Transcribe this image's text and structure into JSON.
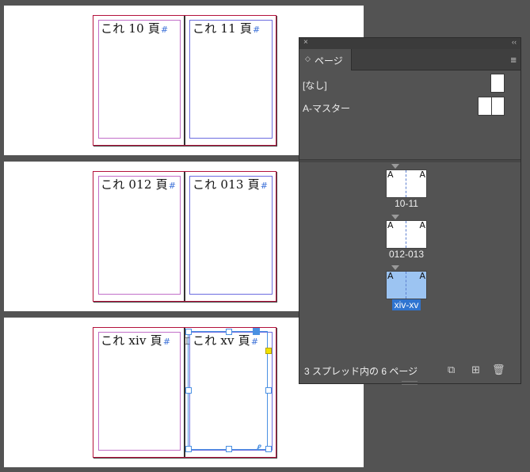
{
  "spreads": [
    {
      "left_label": "これ 10 頁",
      "right_label": "これ 11 頁"
    },
    {
      "left_label": "これ 012 頁",
      "right_label": "これ 013 頁"
    },
    {
      "left_label": "これ xiv 頁",
      "right_label": "これ xv 頁"
    }
  ],
  "marker_glyph": "#",
  "panel": {
    "close_glyph": "×",
    "collapse_glyph": "‹‹",
    "tab_arrows": "◇",
    "tab_label": "ページ",
    "menu_glyph": "≡",
    "masters": [
      {
        "label": "[なし]"
      },
      {
        "label": "A-マスター"
      }
    ],
    "spreads": [
      {
        "name": "10-11",
        "prefix_left": "A",
        "prefix_right": "A",
        "selected": false
      },
      {
        "name": "012-013",
        "prefix_left": "A",
        "prefix_right": "A",
        "selected": false
      },
      {
        "name": "xiv-xv",
        "prefix_left": "A",
        "prefix_right": "A",
        "selected": true
      }
    ],
    "footer_text": "3 スプレッド内の 6 ページ",
    "accent_color": "#2f74d0"
  },
  "icons": {
    "new-page": "⧉",
    "add-page": "⊞",
    "delete": "🗑"
  }
}
